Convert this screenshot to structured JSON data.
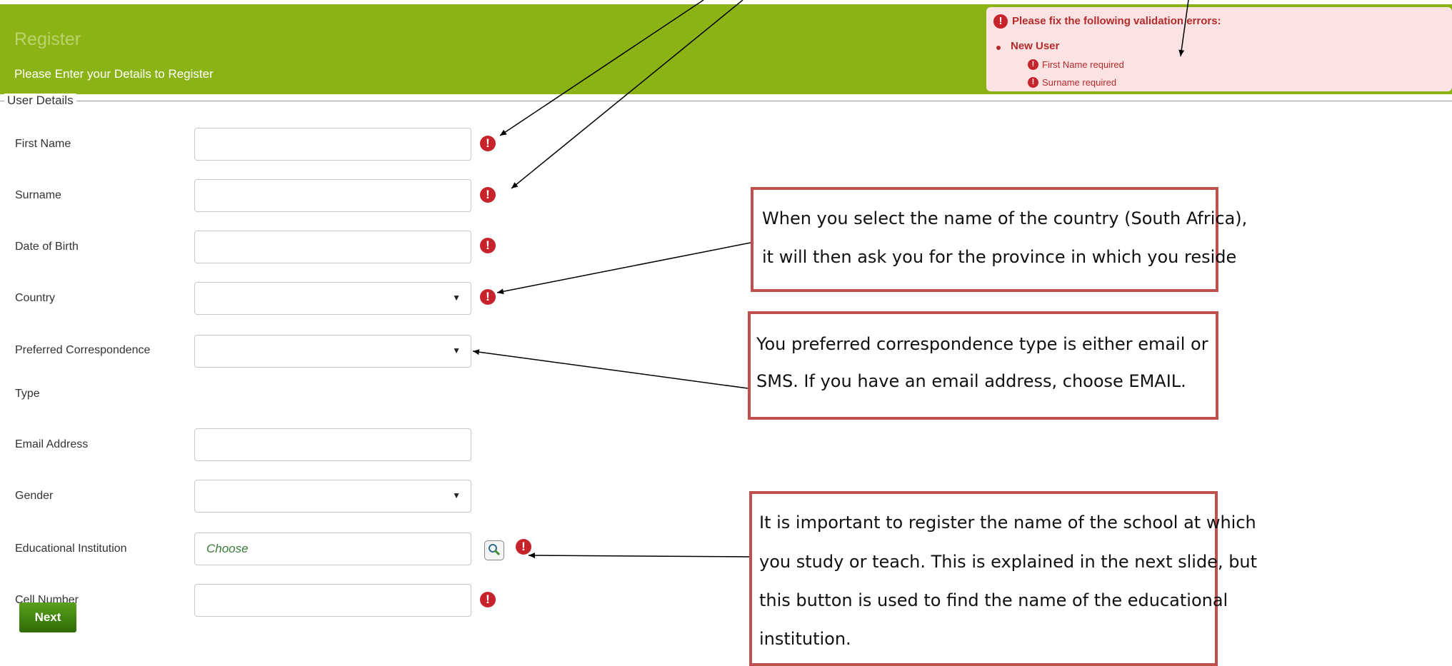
{
  "header": {
    "title": "Register",
    "subtitle": "Please Enter your Details to Register"
  },
  "validation": {
    "heading": "Please fix the following validation errors:",
    "group": "New User",
    "errors": [
      "First Name required",
      "Surname required"
    ]
  },
  "fieldset": {
    "legend": "User Details"
  },
  "form": {
    "first_name_label": "First Name",
    "surname_label": "Surname",
    "dob_label": "Date of Birth",
    "country_label": "Country",
    "pref_label_line1": "Preferred Correspondence",
    "pref_label_line2": "Type",
    "email_label": "Email Address",
    "gender_label": "Gender",
    "edu_label": "Educational Institution",
    "edu_placeholder": "Choose",
    "cell_label": "Cell Number",
    "required_glyph": "!",
    "next_label": "Next"
  },
  "notes": {
    "country": [
      "When you select the name of the country (South Africa),",
      "it will then ask you for the province in which you reside"
    ],
    "correspondence": [
      "You preferred correspondence type is either email or",
      "SMS.  If you have an email address, choose EMAIL."
    ],
    "institution": [
      "It is important to register the name of the school at which",
      "you study or teach.  This is explained in the next slide, but",
      "this button is used to find the name of the educational",
      "institution."
    ]
  },
  "colors": {
    "header_bg": "#8cb315",
    "error_bg": "#fbe3e3",
    "error_text": "#b52a2a",
    "required_icon": "#c7232b",
    "note_border": "#c0504d",
    "next_button": "#3f8510"
  },
  "icons": {
    "required": "exclamation-circle-icon",
    "lookup": "magnifier-icon",
    "dropdown": "caret-down-icon"
  }
}
